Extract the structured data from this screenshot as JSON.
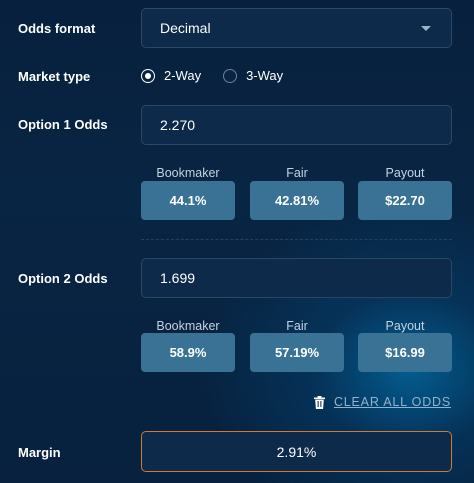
{
  "odds_format": {
    "label": "Odds format",
    "value": "Decimal"
  },
  "market_type": {
    "label": "Market type",
    "options": [
      {
        "label": "2-Way",
        "selected": true
      },
      {
        "label": "3-Way",
        "selected": false
      }
    ]
  },
  "option1": {
    "label": "Option 1 Odds",
    "value": "2.270",
    "stats": [
      {
        "header": "Bookmaker",
        "value": "44.1%"
      },
      {
        "header": "Fair",
        "value": "42.81%"
      },
      {
        "header": "Payout",
        "value": "$22.70"
      }
    ]
  },
  "option2": {
    "label": "Option 2 Odds",
    "value": "1.699",
    "stats": [
      {
        "header": "Bookmaker",
        "value": "58.9%"
      },
      {
        "header": "Fair",
        "value": "57.19%"
      },
      {
        "header": "Payout",
        "value": "$16.99"
      }
    ]
  },
  "clear_label": "CLEAR ALL ODDS",
  "margin": {
    "label": "Margin",
    "value": "2.91%"
  },
  "colors": {
    "background": "#07203d",
    "field": "#0d2a4a",
    "stat_box": "#3a7296",
    "margin_border": "#d07a33",
    "link": "#8fb3cf"
  },
  "icons": {
    "clear": "trash-icon",
    "dropdown": "chevron-down-icon"
  }
}
